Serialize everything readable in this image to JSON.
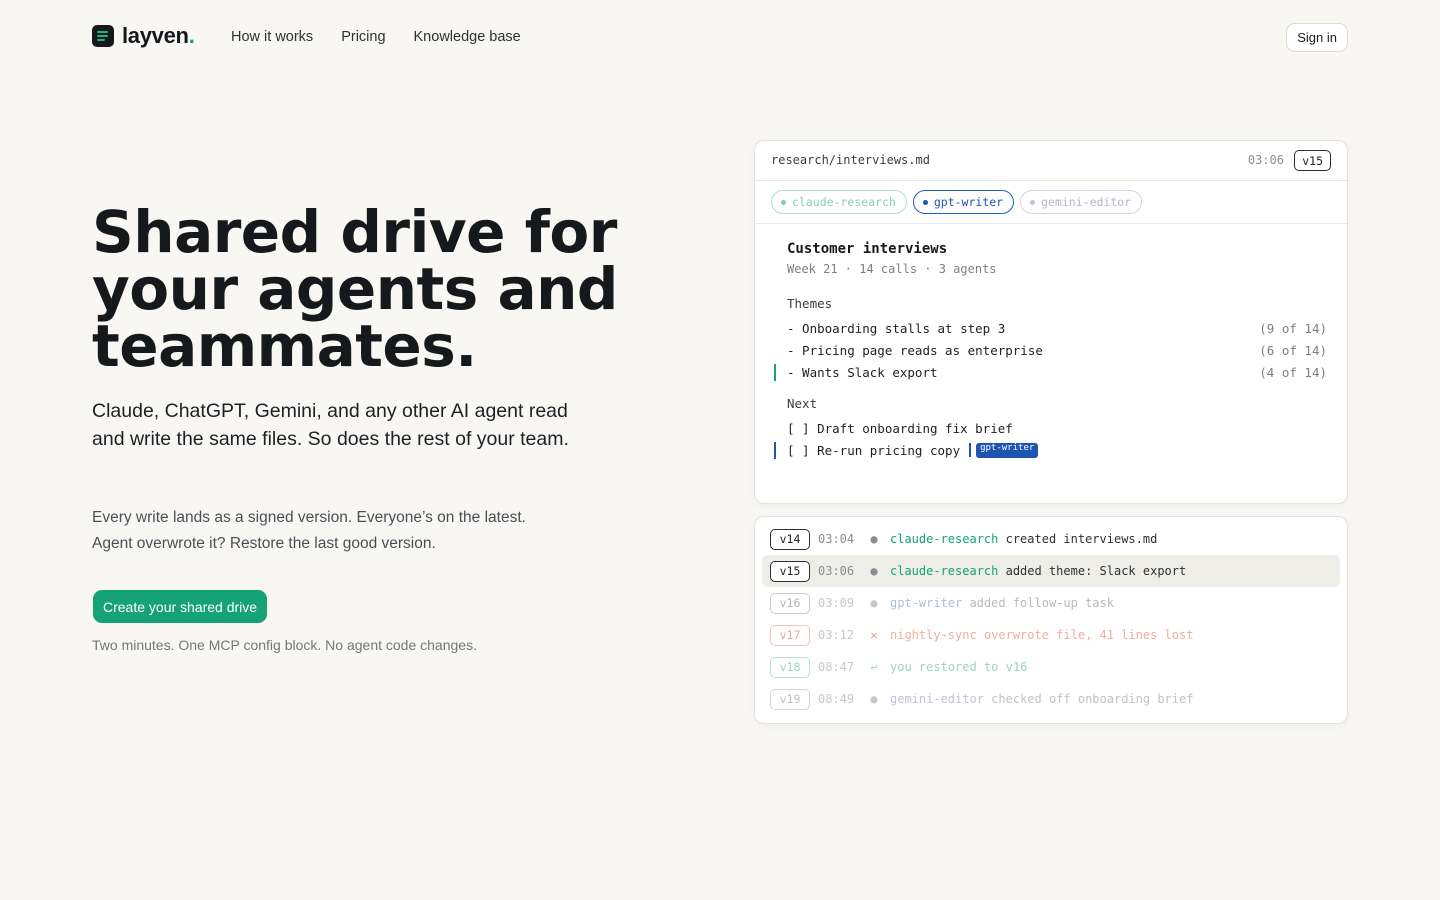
{
  "nav": {
    "logo_text": "layven",
    "logo_dot": ".",
    "links": [
      "How it works",
      "Pricing",
      "Knowledge base"
    ],
    "signin_label": "Sign in"
  },
  "hero": {
    "title_lines": [
      "Shared drive for",
      "your agents and",
      "teammates."
    ],
    "subtitle": "Claude, ChatGPT, Gemini, and any other AI agent read and write the same files. So does the rest of your team.",
    "body_line1": "Every write lands as a signed version. Everyone’s on the latest.",
    "body_line2": "Agent overwrote it? Restore the last good version.",
    "cta_label": "Create your shared drive",
    "cta_note": "Two minutes. One MCP config block. No agent code changes."
  },
  "file_card": {
    "path": "research/interviews.md",
    "time": "03:06",
    "version": "v15",
    "agents": [
      {
        "name": "claude-research",
        "state": "idle"
      },
      {
        "name": "gpt-writer",
        "state": "active"
      },
      {
        "name": "gemini-editor",
        "state": "idle"
      }
    ],
    "doc": {
      "title": "Customer interviews",
      "meta": "Week 21 · 14 calls · 3 agents",
      "themes_heading": "Themes",
      "themes": [
        {
          "text": "- Onboarding stalls at step 3",
          "count": "(9 of 14)"
        },
        {
          "text": "- Pricing page reads as enterprise",
          "count": "(6 of 14)"
        },
        {
          "text": "- Wants Slack export",
          "count": "(4 of 14)"
        }
      ],
      "next_heading": "Next",
      "tasks": [
        {
          "text": "[ ] Draft onboarding fix brief"
        },
        {
          "text": "[ ] Re-run pricing copy",
          "cursor_label": "gpt-writer"
        }
      ]
    }
  },
  "history": [
    {
      "version": "v14",
      "time": "03:04",
      "mark": "●",
      "agent": "claude-research",
      "action": "created interviews.md"
    },
    {
      "version": "v15",
      "time": "03:06",
      "mark": "●",
      "agent": "claude-research",
      "action": "added theme: Slack export"
    },
    {
      "version": "v16",
      "time": "03:09",
      "mark": "●",
      "agent": "gpt-writer",
      "action": "added follow-up task"
    },
    {
      "version": "v17",
      "time": "03:12",
      "mark": "✕",
      "agent": "nightly-sync",
      "action": "overwrote file, 41 lines lost"
    },
    {
      "version": "v18",
      "time": "08:47",
      "mark": "↩",
      "agent": "you",
      "action": "restored to v16"
    },
    {
      "version": "v19",
      "time": "08:49",
      "mark": "●",
      "agent": "gemini-editor",
      "action": "checked off onboarding brief"
    }
  ],
  "colors": {
    "accent": "#14a276",
    "gpt_blue": "#1e55b3",
    "error": "#e06c5a",
    "background": "#f8f7f4"
  }
}
